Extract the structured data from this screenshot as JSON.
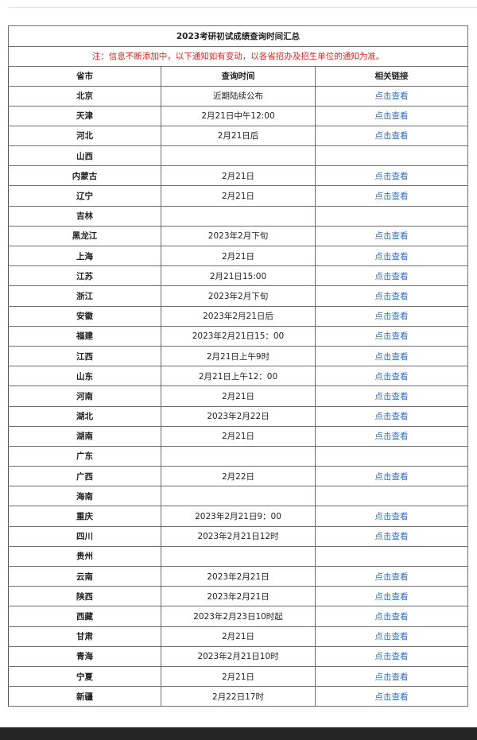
{
  "table": {
    "title": "2023考研初试成绩查询时间汇总",
    "note": "注：信息不断添加中，以下通知如有变动，以各省招办及招生单位的通知为准。",
    "headers": [
      "省市",
      "查询时间",
      "相关链接"
    ],
    "link_color": "#2a6fd1",
    "note_color": "#e8231f",
    "rows": [
      {
        "province": "北京",
        "time": "近期陆续公布",
        "link": "点击查看"
      },
      {
        "province": "天津",
        "time": "2月21日中午12:00",
        "link": "点击查看"
      },
      {
        "province": "河北",
        "time": "2月21日后",
        "link": "点击查看"
      },
      {
        "province": "山西",
        "time": "",
        "link": ""
      },
      {
        "province": "内蒙古",
        "time": "2月21日",
        "link": "点击查看"
      },
      {
        "province": "辽宁",
        "time": "2月21日",
        "link": "点击查看"
      },
      {
        "province": "吉林",
        "time": "",
        "link": ""
      },
      {
        "province": "黑龙江",
        "time": "2023年2月下旬",
        "link": "点击查看"
      },
      {
        "province": "上海",
        "time": "2月21日",
        "link": "点击查看"
      },
      {
        "province": "江苏",
        "time": "2月21日15:00",
        "link": "点击查看"
      },
      {
        "province": "浙江",
        "time": "2023年2月下旬",
        "link": "点击查看"
      },
      {
        "province": "安徽",
        "time": "2023年2月21日后",
        "link": "点击查看"
      },
      {
        "province": "福建",
        "time": "2023年2月21日15：00",
        "link": "点击查看"
      },
      {
        "province": "江西",
        "time": "2月21日上午9时",
        "link": "点击查看"
      },
      {
        "province": "山东",
        "time": "2月21日上午12：00",
        "link": "点击查看"
      },
      {
        "province": "河南",
        "time": "2月21日",
        "link": "点击查看"
      },
      {
        "province": "湖北",
        "time": "2023年2月22日",
        "link": "点击查看"
      },
      {
        "province": "湖南",
        "time": "2月21日",
        "link": "点击查看"
      },
      {
        "province": "广东",
        "time": "",
        "link": ""
      },
      {
        "province": "广西",
        "time": "2月22日",
        "link": "点击查看"
      },
      {
        "province": "海南",
        "time": "",
        "link": ""
      },
      {
        "province": "重庆",
        "time": "2023年2月21日9：00",
        "link": "点击查看"
      },
      {
        "province": "四川",
        "time": "2023年2月21日12时",
        "link": "点击查看"
      },
      {
        "province": "贵州",
        "time": "",
        "link": ""
      },
      {
        "province": "云南",
        "time": "2023年2月21日",
        "link": "点击查看"
      },
      {
        "province": "陕西",
        "time": "2023年2月21日",
        "link": "点击查看"
      },
      {
        "province": "西藏",
        "time": "2023年2月23日10时起",
        "link": "点击查看"
      },
      {
        "province": "甘肃",
        "time": "2月21日",
        "link": "点击查看"
      },
      {
        "province": "青海",
        "time": "2023年2月21日10时",
        "link": "点击查看"
      },
      {
        "province": "宁夏",
        "time": "2月21日",
        "link": "点击查看"
      },
      {
        "province": "新疆",
        "time": "2月22日17时",
        "link": "点击查看"
      }
    ]
  }
}
